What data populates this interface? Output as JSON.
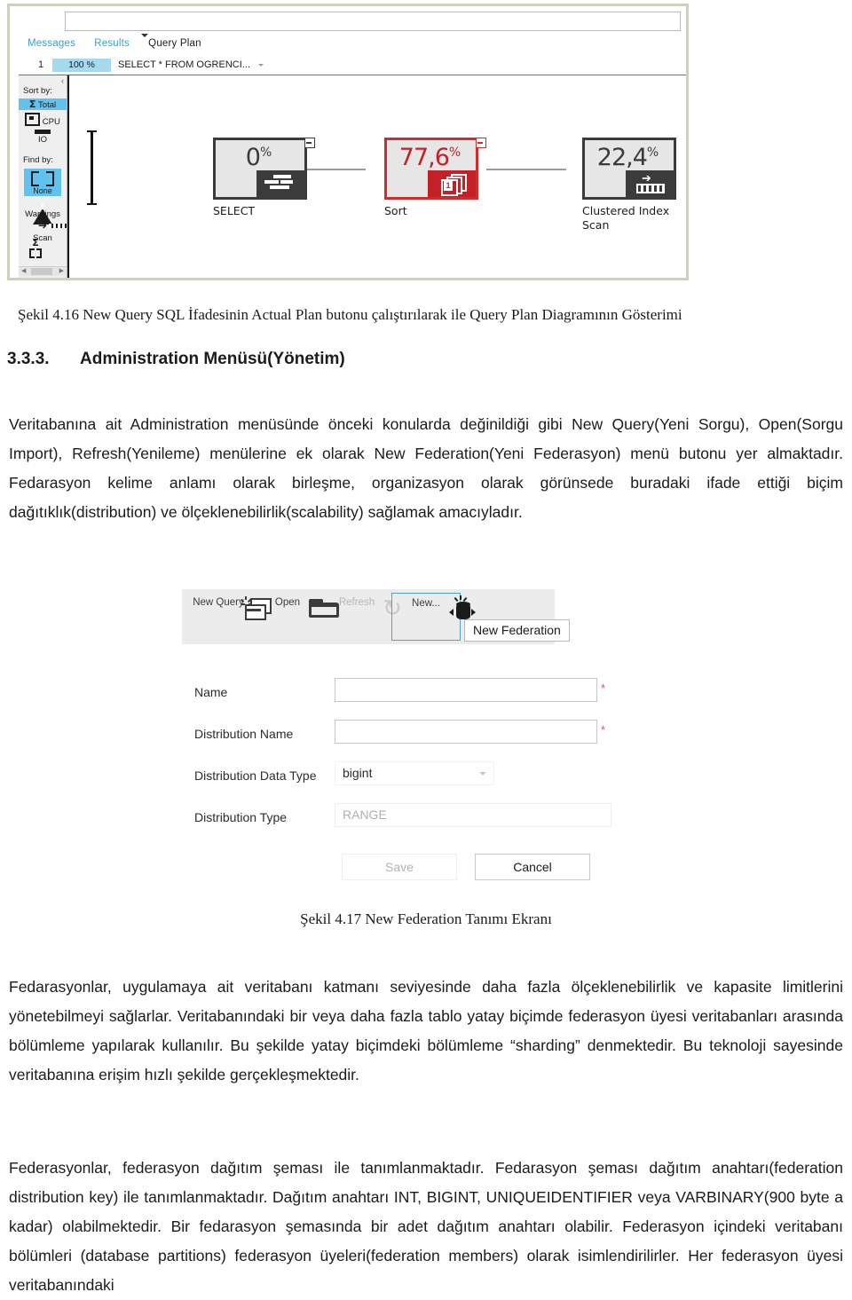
{
  "figure_query_plan": {
    "toolbar_tabs": [
      {
        "label": "Messages",
        "active": false
      },
      {
        "label": "Results",
        "active": false
      },
      {
        "label": "Query Plan",
        "active": true
      }
    ],
    "query_row": {
      "row_number": "1",
      "cost_percent": "100 %",
      "statement": "SELECT * FROM OGRENCI..."
    },
    "rail": {
      "sort_by_label": "Sort by:",
      "sort_options": [
        {
          "label": "Total",
          "icon": "sigma-icon",
          "selected": true
        },
        {
          "label": "CPU",
          "icon": "cpu-icon",
          "selected": false
        },
        {
          "label": "IO",
          "icon": "io-icon",
          "selected": false
        }
      ],
      "find_by_label": "Find by:",
      "find_options": [
        {
          "label": "None",
          "icon": "crop-brackets-icon",
          "selected": true
        },
        {
          "label": "Warnings",
          "icon": "warning-triangle-icon",
          "selected": false
        },
        {
          "label": "Scan",
          "icon": "scan-icon",
          "selected": false
        }
      ]
    },
    "nodes": [
      {
        "label": "SELECT",
        "cost_whole": "0",
        "cost_sup": "%",
        "accent": "gray",
        "icon": "select-icon"
      },
      {
        "label": "Sort",
        "cost_whole": "77,6",
        "cost_sup": "%",
        "accent": "red",
        "icon": "sort-icon"
      },
      {
        "label": "Clustered Index\nScan",
        "cost_whole": "22,4",
        "cost_sup": "%",
        "accent": "gray",
        "icon": "clustered-index-scan-icon"
      }
    ],
    "node_labels": {
      "select": "SELECT",
      "sort": "Sort",
      "scan_line1": "Clustered Index",
      "scan_line2": "Scan"
    },
    "node_costs": {
      "select": "0",
      "sort": "77,6",
      "scan": "22,4",
      "suffix": "%"
    },
    "colors": {
      "accent_red": "#c22127",
      "accent_blue": "#62c2ef",
      "frame_green": "#ccd3bc"
    }
  },
  "captions": {
    "figure_416": "Şekil 4.16 New Query SQL İfadesinin Actual Plan butonu çalıştırılarak ile Query Plan Diagramının Gösterimi",
    "figure_417": "Şekil 4.17 New Federation Tanımı Ekranı"
  },
  "heading": {
    "number": "3.3.3.",
    "text": "Administration Menüsü(Yönetim)"
  },
  "paragraphs": {
    "p1": "Veritabanına ait Administration menüsünde önceki konularda değinildiği gibi New Query(Yeni Sorgu), Open(Sorgu Import), Refresh(Yenileme) menülerine ek olarak New Federation(Yeni Federasyon) menü butonu yer almaktadır. Fedarasyon kelime anlamı olarak birleşme, organizasyon olarak görünsede buradaki ifade ettiği biçim dağıtıklık(distribution) ve ölçeklenebilirlik(scalability) sağlamak amacıyladır.",
    "p2": "Fedarasyonlar, uygulamaya ait veritabanı katmanı seviyesinde daha fazla ölçeklenebilirlik ve kapasite limitlerini yönetebilmeyi sağlarlar. Veritabanındaki bir veya daha fazla tablo yatay biçimde federasyon üyesi veritabanları arasında bölümleme yapılarak kullanılır. Bu şekilde yatay biçimdeki bölümleme “sharding” denmektedir. Bu teknoloji sayesinde veritabanına erişim hızlı şekilde gerçekleşmektedir.",
    "p3": "Federasyonlar, federasyon dağıtım şeması ile tanımlanmaktadır. Fedarasyon şeması dağıtım anahtarı(federation distribution key) ile tanımlanmaktadır. Dağıtım anahtarı INT, BIGINT, UNIQUEIDENTIFIER veya VARBINARY(900 byte a kadar) olabilmektedir. Bir fedarasyon şemasında bir adet dağıtım anahtarı olabilir. Federasyon içindeki veritabanı bölümleri (database partitions) federasyon üyeleri(federation members) olarak isimlendirilirler. Her federasyon üyesi veritabanındaki"
  },
  "figure_federation": {
    "toolbar": [
      {
        "label": "New Query",
        "icon": "new-query-icon",
        "disabled": false,
        "selected": false
      },
      {
        "label": "Open",
        "icon": "open-folder-icon",
        "disabled": false,
        "selected": false
      },
      {
        "label": "Refresh",
        "icon": "refresh-icon",
        "disabled": true,
        "selected": false
      },
      {
        "label": "New...",
        "icon": "new-federation-icon",
        "disabled": false,
        "selected": true
      }
    ],
    "toolbar_labels": {
      "new_query": "New Query",
      "open": "Open",
      "refresh": "Refresh",
      "new_federation": "New..."
    },
    "tooltip": "New Federation",
    "fields": {
      "name_label": "Name",
      "name_value": "",
      "distribution_name_label": "Distribution Name",
      "distribution_name_value": "",
      "distribution_data_type_label": "Distribution Data Type",
      "distribution_data_type_value": "bigint",
      "distribution_type_label": "Distribution Type",
      "distribution_type_value": "RANGE",
      "required_marker": "*"
    },
    "buttons": {
      "save": "Save",
      "cancel": "Cancel"
    }
  }
}
